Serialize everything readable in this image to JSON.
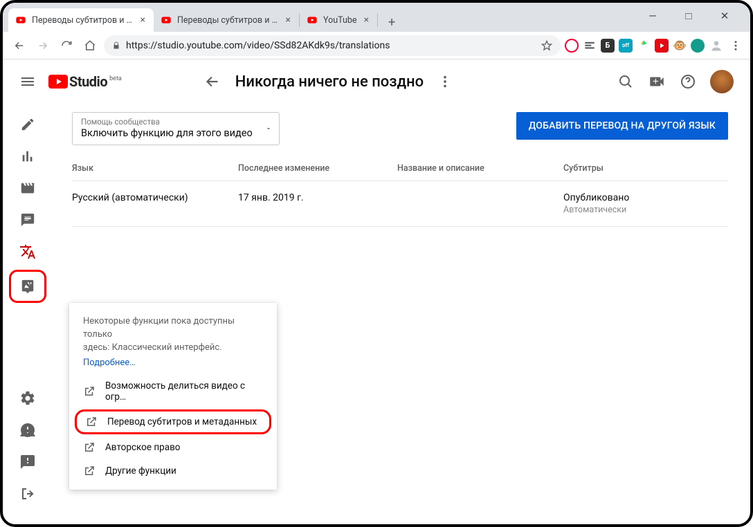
{
  "window": {
    "minimize": "—",
    "maximize": "□",
    "close": "✕"
  },
  "tabs": [
    {
      "title": "Переводы субтитров и метадан…",
      "favicon": "youtube",
      "active": true
    },
    {
      "title": "Переводы субтитров и метадан…",
      "favicon": "youtube",
      "active": false
    },
    {
      "title": "YouTube",
      "favicon": "youtube",
      "active": false
    }
  ],
  "addressbar": {
    "url": "https://studio.youtube.com/video/SSd82AKdk9s/translations"
  },
  "header": {
    "logo_text": "Studio",
    "logo_beta": "beta",
    "video_title": "Никогда ничего не поздно"
  },
  "sidebar": {
    "items": [
      {
        "name": "details",
        "icon": "pencil"
      },
      {
        "name": "analytics",
        "icon": "bar-chart"
      },
      {
        "name": "editor",
        "icon": "clapperboard"
      },
      {
        "name": "comments",
        "icon": "comment"
      },
      {
        "name": "translations",
        "icon": "translate",
        "active": true
      },
      {
        "name": "other-features",
        "icon": "research",
        "highlighted": true
      }
    ],
    "bottom": [
      {
        "name": "settings",
        "icon": "gear"
      },
      {
        "name": "whats-new",
        "icon": "alert"
      },
      {
        "name": "feedback",
        "icon": "feedback"
      },
      {
        "name": "classic",
        "icon": "exit"
      }
    ]
  },
  "main": {
    "community_label": "Помощь сообщества",
    "community_value": "Включить функцию для этого видео",
    "add_lang_button": "ДОБАВИТЬ ПЕРЕВОД НА ДРУГОЙ ЯЗЫК",
    "columns": {
      "language": "Язык",
      "modified": "Последнее изменение",
      "name_desc": "Название и описание",
      "subtitles": "Субтитры"
    },
    "rows": [
      {
        "language": "Русский (автоматически)",
        "modified": "17 янв. 2019 г.",
        "name_desc": "",
        "subtitles_status": "Опубликовано",
        "subtitles_note": "Автоматически"
      }
    ]
  },
  "popup": {
    "text_line1": "Некоторые функции пока доступны только",
    "text_line2": "здесь: Классический интерфейс.",
    "link": "Подробнее…",
    "items": [
      {
        "label": "Возможность делиться видео с огр…"
      },
      {
        "label": "Перевод субтитров и метаданных",
        "highlighted": true
      },
      {
        "label": "Авторское право"
      },
      {
        "label": "Другие функции"
      }
    ]
  }
}
